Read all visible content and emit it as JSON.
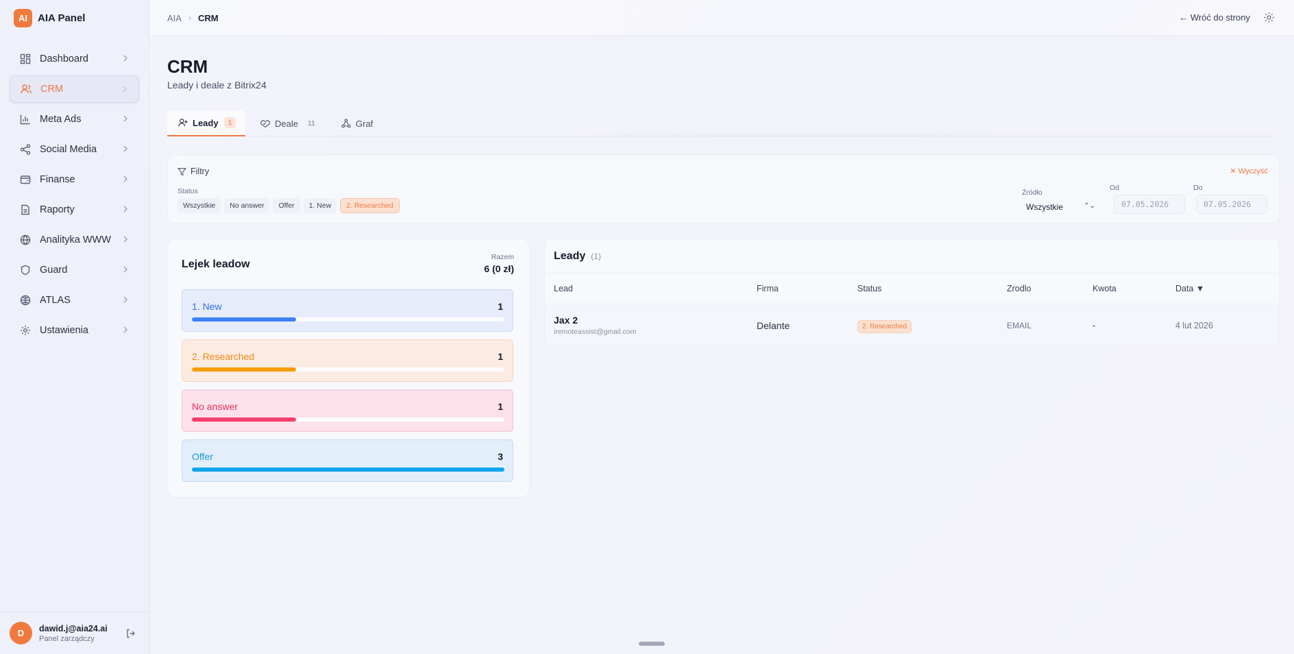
{
  "brand": {
    "logo": "AI",
    "name": "AIA Panel"
  },
  "sidebar": {
    "items": [
      {
        "label": "Dashboard",
        "icon": "dashboard-icon"
      },
      {
        "label": "CRM",
        "icon": "users-icon",
        "active": true
      },
      {
        "label": "Meta Ads",
        "icon": "bar-chart-icon"
      },
      {
        "label": "Social Media",
        "icon": "share-icon"
      },
      {
        "label": "Finanse",
        "icon": "wallet-icon"
      },
      {
        "label": "Raporty",
        "icon": "report-icon"
      },
      {
        "label": "Analityka WWW",
        "icon": "globe-icon"
      },
      {
        "label": "Guard",
        "icon": "shield-icon"
      },
      {
        "label": "ATLAS",
        "icon": "atlas-icon"
      },
      {
        "label": "Ustawienia",
        "icon": "gear-icon"
      }
    ]
  },
  "user": {
    "initial": "D",
    "email": "dawid.j@aia24.ai",
    "role": "Panel zarządczy"
  },
  "topbar": {
    "crumb_root": "AIA",
    "crumb_current": "CRM",
    "back_label": "← Wróć do strony"
  },
  "page": {
    "title": "CRM",
    "subtitle": "Leady i deale z Bitrix24"
  },
  "tabs": [
    {
      "label": "Leady",
      "count": "1",
      "active": true
    },
    {
      "label": "Deale",
      "count": "11"
    },
    {
      "label": "Graf",
      "count": ""
    }
  ],
  "filters": {
    "title": "Filtry",
    "clear_label": "Wyczyść",
    "status_label": "Status",
    "status_options": [
      "Wszystkie",
      "No answer",
      "Offer",
      "1. New",
      "2. Researched"
    ],
    "status_selected": "2. Researched",
    "source_label": "Źródło",
    "source_value": "Wszystkie",
    "from_label": "Od",
    "from_value": "07.05.2026",
    "to_label": "Do",
    "to_value": "07.05.2026"
  },
  "funnel": {
    "title": "Lejek leadow",
    "total_label": "Razem",
    "total_value": "6 (0 zł)",
    "stages": [
      {
        "name": "1. New",
        "count": "1",
        "fraction": 0.333,
        "color": "#3b82f6",
        "bg": "#e7ecfb",
        "border": "#c9d6f6",
        "text": "#2f6fe0"
      },
      {
        "name": "2. Researched",
        "count": "1",
        "fraction": 0.333,
        "color": "#f59e0b",
        "bg": "#fcebe0",
        "border": "#f6d3bd",
        "text": "#ec8a1a"
      },
      {
        "name": "No answer",
        "count": "1",
        "fraction": 0.333,
        "color": "#f43f6a",
        "bg": "#fce1ea",
        "border": "#f6c3d2",
        "text": "#e5305e"
      },
      {
        "name": "Offer",
        "count": "3",
        "fraction": 1.0,
        "color": "#0ea5e9",
        "bg": "#e3eefb",
        "border": "#c5dcf4",
        "text": "#1a94d6"
      }
    ]
  },
  "leads": {
    "title": "Leady",
    "count": "(1)",
    "columns": [
      "Lead",
      "Firma",
      "Status",
      "Zrodlo",
      "Kwota",
      "Data ▼"
    ],
    "rows": [
      {
        "name": "Jax 2",
        "email": "iremoteassist@gmail.com",
        "company": "Delante",
        "status": "2. Researched",
        "source": "EMAIL",
        "amount": "-",
        "date": "4 lut 2026"
      }
    ]
  }
}
